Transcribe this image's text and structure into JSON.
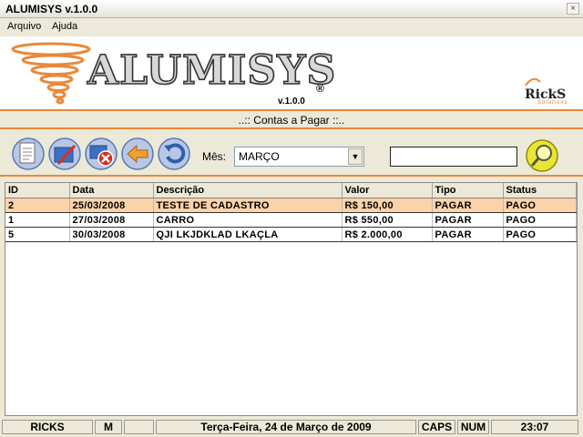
{
  "window": {
    "title": "ALUMISYS v.1.0.0",
    "close_glyph": "×"
  },
  "menu": {
    "items": [
      "Arquivo",
      "Ajuda"
    ]
  },
  "brand": {
    "name": "ALUMISYS",
    "registered": "®",
    "version": "v.1.0.0",
    "company": "RickS",
    "company_sub": "Solutions",
    "accent_color": "#e9883a"
  },
  "section": {
    "title": "..:: Contas a Pagar ::.."
  },
  "toolbar": {
    "buttons": [
      "new-document-icon",
      "edit-icon",
      "delete-icon",
      "back-arrow-icon",
      "undo-icon"
    ],
    "month_label": "Mês:",
    "month_value": "MARÇO",
    "search_value": "",
    "search_icon": "magnifier-icon"
  },
  "table": {
    "columns": [
      "ID",
      "Data",
      "Descrição",
      "Valor",
      "Tipo",
      "Status"
    ],
    "rows": [
      [
        "2",
        "25/03/2008",
        "TESTE DE CADASTRO",
        "R$ 150,00",
        "PAGAR",
        "PAGO"
      ],
      [
        "1",
        "27/03/2008",
        "CARRO",
        "R$ 550,00",
        "PAGAR",
        "PAGO"
      ],
      [
        "5",
        "30/03/2008",
        "QJI LKJDKLAD LKAÇLA",
        "R$ 2.000,00",
        "PAGAR",
        "PAGO"
      ]
    ],
    "selected_row": 0,
    "selected_color": "#fbd3a8"
  },
  "status": {
    "user": "RICKS",
    "flag": "M",
    "empty": "",
    "date": "Terça-Feira, 24 de Março de 2009",
    "caps": "CAPS",
    "num": "NUM",
    "time": "23:07"
  }
}
